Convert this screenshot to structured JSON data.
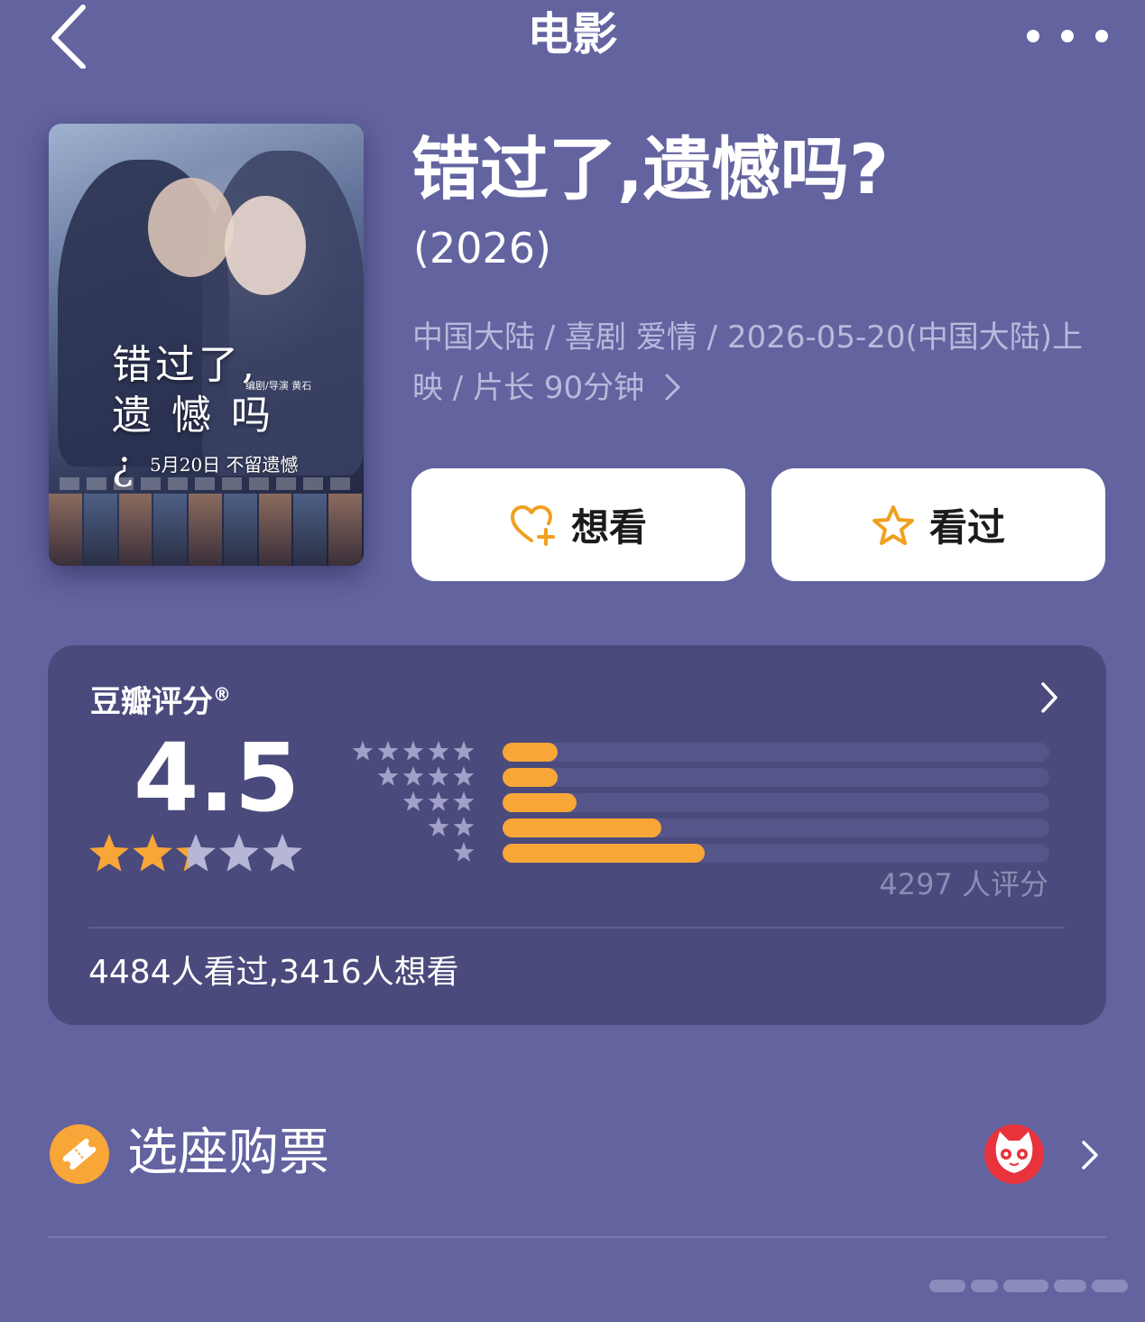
{
  "nav": {
    "title": "电影",
    "back_icon": "chevron-left-icon",
    "more_icon": "more-dots-icon"
  },
  "poster": {
    "title_line1": "错过了,",
    "title_line2": "遗 憾 吗¿",
    "credit": "编剧/导演 黄石",
    "date_text": "5月20日 不留遗憾"
  },
  "movie": {
    "title": "错过了,遗憾吗?",
    "year": "(2026)",
    "meta": "中国大陆 / 喜剧 爱情 / 2026-05-20(中国大陆)上映 / 片长 90分钟",
    "meta_chevron": ">"
  },
  "actions": {
    "want_label": "想看",
    "want_icon": "heart-plus-icon",
    "seen_label": "看过",
    "seen_icon": "star-outline-icon",
    "icon_color": "#f0a020"
  },
  "rating": {
    "title": "豆瓣评分",
    "title_mark": "®",
    "score": "4.5",
    "stars_filled": 2.3,
    "distribution": [
      {
        "stars": 5,
        "fraction": 0.1
      },
      {
        "stars": 4,
        "fraction": 0.1
      },
      {
        "stars": 3,
        "fraction": 0.135
      },
      {
        "stars": 2,
        "fraction": 0.29
      },
      {
        "stars": 1,
        "fraction": 0.37
      }
    ],
    "count_text": "4297 人评分",
    "watch_stats": "4484人看过,3416人想看",
    "bar_color": "#f8a637",
    "star_color": "#f8a637"
  },
  "ticket": {
    "label": "选座购票",
    "icon": "ticket-icon",
    "logo": "maoyan-cat-logo",
    "chevron": "chevron-right-icon"
  }
}
